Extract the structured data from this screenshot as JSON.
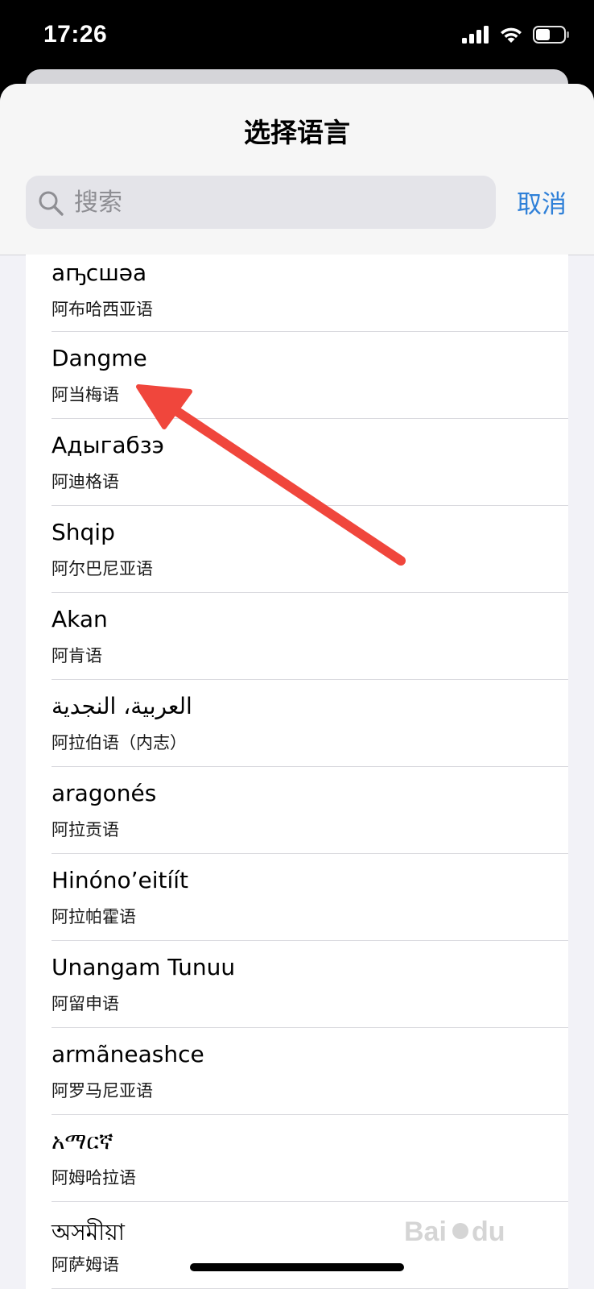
{
  "status_bar": {
    "time": "17:26"
  },
  "sheet": {
    "title": "选择语言",
    "search_placeholder": "搜索",
    "cancel_label": "取消"
  },
  "languages": [
    {
      "native": "аҧсшәа",
      "chinese": "阿布哈西亚语"
    },
    {
      "native": "Dangme",
      "chinese": "阿当梅语"
    },
    {
      "native": "Адыгабзэ",
      "chinese": "阿迪格语"
    },
    {
      "native": "Shqip",
      "chinese": "阿尔巴尼亚语"
    },
    {
      "native": "Akan",
      "chinese": "阿肯语"
    },
    {
      "native": "العربية، النجدية",
      "chinese": "阿拉伯语（内志）"
    },
    {
      "native": "aragonés",
      "chinese": "阿拉贡语"
    },
    {
      "native": "Hinóno’eitíít",
      "chinese": "阿拉帕霍语"
    },
    {
      "native": "Unangam Tunuu",
      "chinese": "阿留申语"
    },
    {
      "native": "armãneashce",
      "chinese": "阿罗马尼亚语"
    },
    {
      "native": "አማርኛ",
      "chinese": "阿姆哈拉语"
    },
    {
      "native": "অসমীয়া",
      "chinese": "阿萨姆语"
    }
  ],
  "colors": {
    "accent": "#2f80d8",
    "annotation_arrow": "#f0463c"
  },
  "icons": {
    "search": "search-icon",
    "signal": "cellular-signal-icon",
    "wifi": "wifi-icon",
    "battery": "battery-icon"
  }
}
